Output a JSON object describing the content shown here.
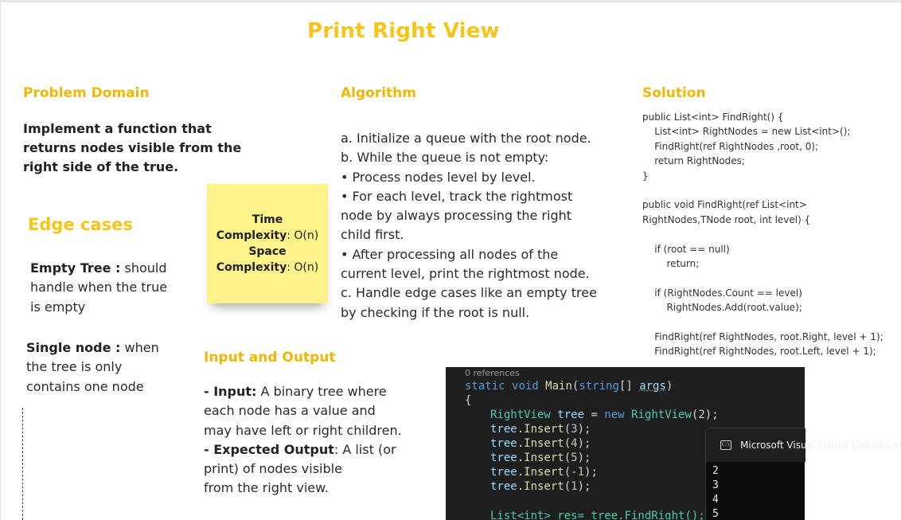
{
  "title": "Print Right View",
  "problem": {
    "heading": "Problem Domain",
    "lines": [
      "Implement a function that",
      "returns nodes visible from the",
      "right side of the true."
    ]
  },
  "edge_cases": {
    "heading": "Edge cases",
    "empty_label": "Empty Tree :",
    "empty_text": [
      " should",
      "handle when the true",
      "is empty"
    ],
    "single_label": "Single node :",
    "single_text": [
      " when",
      "the tree is only",
      "contains one node"
    ]
  },
  "sticky": {
    "time_label": "Time",
    "time_label2": "Complexity",
    "time_value": ": O(n)",
    "space_label": "Space",
    "space_label2": "Complexity",
    "space_value": ": O(n)"
  },
  "algorithm": {
    "heading": "Algorithm",
    "lines": [
      "a. Initialize a queue with the root node.",
      "b. While the queue is not empty:",
      "• Process nodes level by level.",
      "• For each level, track the rightmost",
      "node by always processing the right",
      "child first.",
      "• After processing all nodes of the",
      "current level, print the rightmost node.",
      "c. Handle edge cases like an empty tree",
      "by checking if the root is null."
    ]
  },
  "io": {
    "heading": "Input and Output",
    "input_label": "- Input:",
    "input_lines": [
      " A binary tree where",
      "each node has a value and",
      "may have left or right children."
    ],
    "output_label": "- Expected Output",
    "output_lines": [
      ": A list (or",
      "print) of nodes visible",
      "from the right view."
    ]
  },
  "solution": {
    "heading": "Solution",
    "lines": [
      "public List<int> FindRight() {",
      "    List<int> RightNodes = new List<int>();",
      "    FindRight(ref RightNodes ,root, 0);",
      "    return RightNodes;",
      "}",
      "",
      "public void FindRight(ref List<int>",
      "RightNodes,TNode root, int level) {",
      "",
      "    if (root == null)",
      "        return;",
      "",
      "    if (RightNodes.Count == level)",
      "        RightNodes.Add(root.value);",
      "",
      "    FindRight(ref RightNodes, root.Right, level + 1);",
      "    FindRight(ref RightNodes, root.Left, level + 1);"
    ]
  },
  "editor": {
    "references": "0 references",
    "main_kw1": "static",
    "main_kw2": "void",
    "main_fn": "Main",
    "main_open": "(",
    "main_type": "string",
    "main_arr": "[] ",
    "main_arg": "args",
    "main_close": ")",
    "brace": "{",
    "decl_type": "RightView",
    "decl_var": "tree",
    "decl_eq": " = ",
    "decl_new": "new",
    "decl_ctor": "RightView",
    "decl_args": "(2);",
    "inserts": [
      {
        "obj": "tree",
        "call": ".Insert",
        "arg": "3"
      },
      {
        "obj": "tree",
        "call": ".Insert",
        "arg": "4"
      },
      {
        "obj": "tree",
        "call": ".Insert",
        "arg": "5"
      },
      {
        "obj": "tree",
        "call": ".Insert",
        "arg": "-1"
      },
      {
        "obj": "tree",
        "call": ".Insert",
        "arg": "1"
      }
    ],
    "last_line": "List<int> res= tree.FindRight();"
  },
  "console": {
    "title": "Microsoft Visual Studio Debug Console",
    "output": [
      "2",
      "3",
      "4",
      "5"
    ]
  },
  "colors": {
    "accent": "#f2b705",
    "sticky": "#fdf38b",
    "editor_bg": "#1e1e1e"
  }
}
